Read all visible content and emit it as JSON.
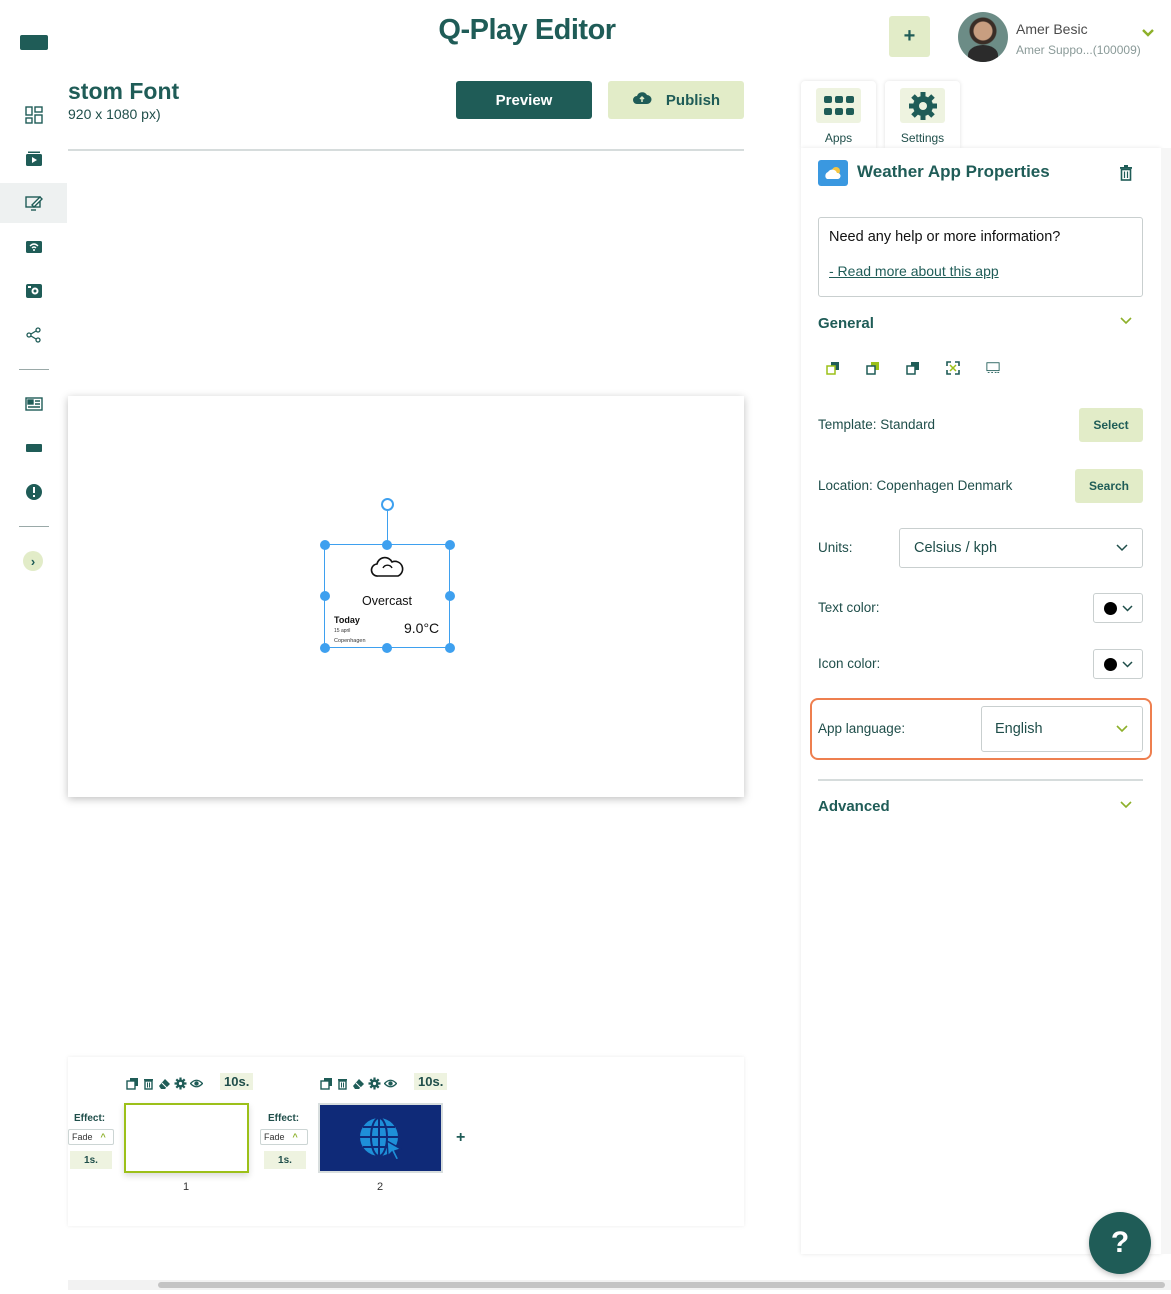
{
  "header": {
    "title": "Q-Play Editor",
    "add_label": "+",
    "user": {
      "name": "Amer Besic",
      "org": "Amer Suppo...(100009)"
    }
  },
  "left_rail": {
    "items": [
      "dashboard-icon",
      "media-icon",
      "editor-icon",
      "wifi-display-icon",
      "player-icon",
      "share-icon",
      "news-icon",
      "screen-icon",
      "alert-icon"
    ],
    "expand_label": "›"
  },
  "canvas": {
    "project_title": "stom Font",
    "project_size": "920 x 1080 px)",
    "preview_label": "Preview",
    "publish_label": "Publish"
  },
  "weather_widget": {
    "condition": "Overcast",
    "today_label": "Today",
    "date": "15 april",
    "city": "Copenhagen",
    "temperature": "9.0°C"
  },
  "timeline": {
    "slides": [
      {
        "number": "1",
        "duration": "10s.",
        "effect_label": "Effect:",
        "effect": "Fade",
        "effect_duration": "1s."
      },
      {
        "number": "2",
        "duration": "10s.",
        "effect_label": "Effect:",
        "effect": "Fade",
        "effect_duration": "1s."
      }
    ],
    "add_label": "+"
  },
  "panel": {
    "tabs": [
      {
        "label": "Apps"
      },
      {
        "label": "Settings"
      }
    ],
    "title": "Weather App Properties",
    "help_text": "Need any help or more information?",
    "help_link": "- Read more about this app",
    "general_title": "General",
    "template_label": "Template: Standard",
    "template_button": "Select",
    "location_label": "Location: Copenhagen Denmark",
    "location_button": "Search",
    "units_label": "Units:",
    "units_value": "Celsius / kph",
    "text_color_label": "Text color:",
    "text_color": "#000000",
    "icon_color_label": "Icon color:",
    "icon_color": "#000000",
    "language_label": "App language:",
    "language_value": "English",
    "advanced_title": "Advanced"
  },
  "help_fab_label": "?",
  "colors": {
    "brand": "#1f5c57",
    "accent": "#e2ecc8",
    "highlight": "#ee7f4f",
    "selection": "#3ea0ef"
  }
}
